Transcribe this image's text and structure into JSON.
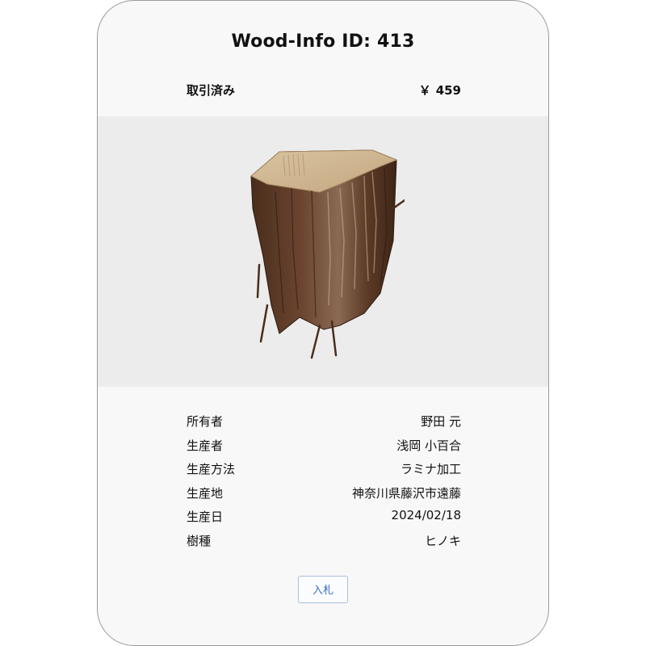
{
  "card": {
    "title": "Wood-Info ID: 413",
    "status": "取引済み",
    "price_symbol": "￥",
    "price": "459"
  },
  "image": {
    "subject": "wood-log-icon"
  },
  "details": [
    {
      "label": "所有者",
      "value": "野田 元"
    },
    {
      "label": "生産者",
      "value": "浅岡 小百合"
    },
    {
      "label": "生産方法",
      "value": "ラミナ加工"
    },
    {
      "label": "生産地",
      "value": "神奈川県藤沢市遠藤"
    },
    {
      "label": "生産日",
      "value": "2024/02/18"
    },
    {
      "label": "樹種",
      "value": "ヒノキ"
    }
  ],
  "actions": {
    "bid_label": "入札"
  },
  "colors": {
    "card_bg": "#f8f8f8",
    "image_bg": "#ececec",
    "button_text": "#3a6ebf",
    "button_border": "#a9bfe0"
  }
}
